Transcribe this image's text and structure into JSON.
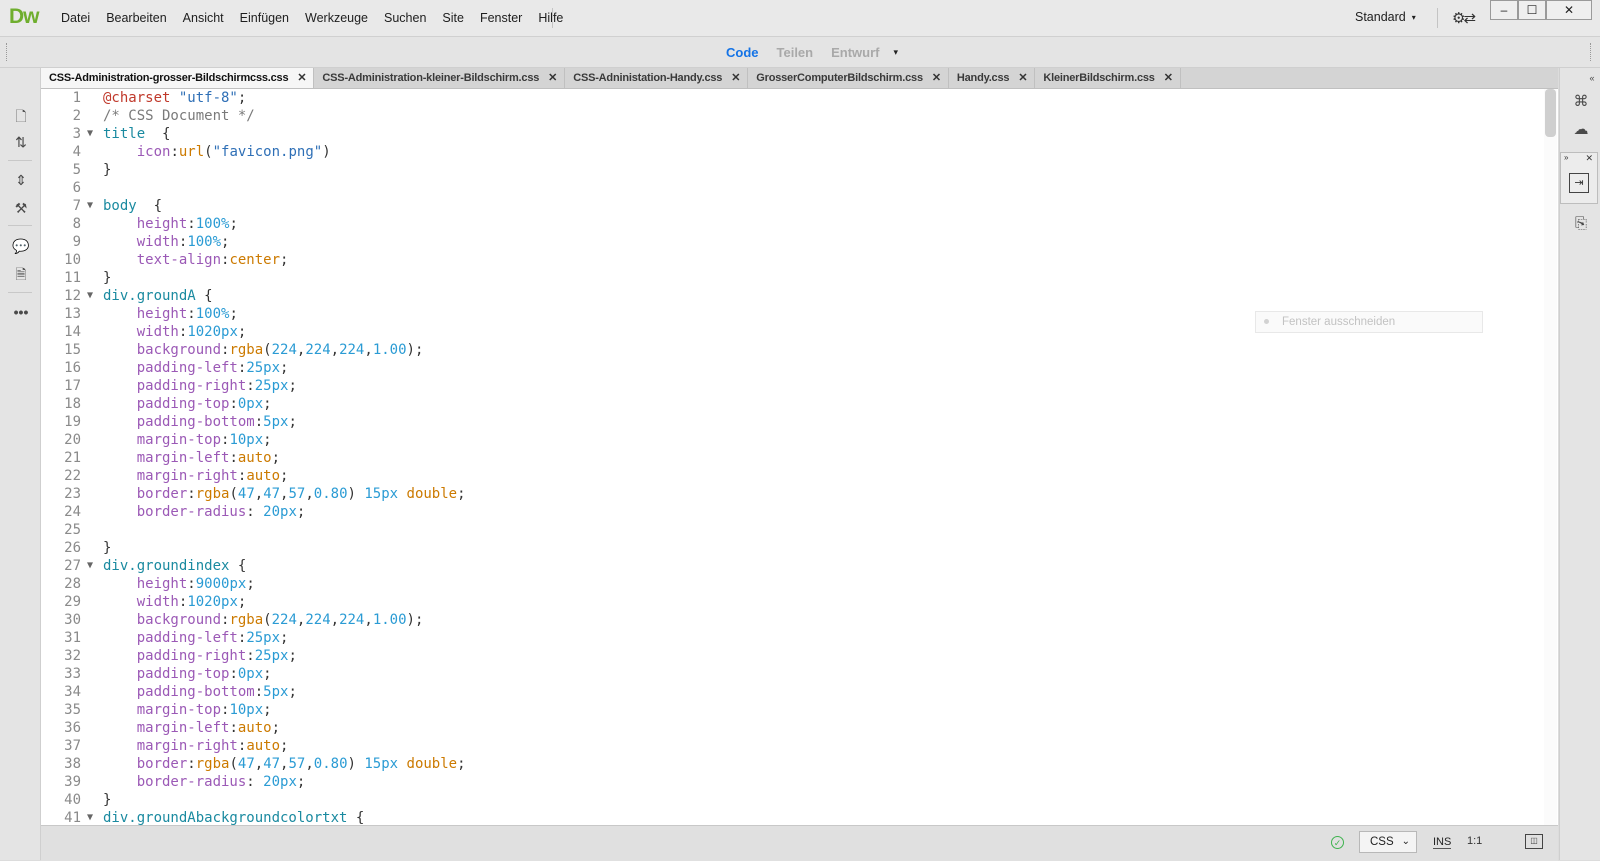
{
  "app": {
    "logo": "Dw"
  },
  "menu": [
    "Datei",
    "Bearbeiten",
    "Ansicht",
    "Einfügen",
    "Werkzeuge",
    "Suchen",
    "Site",
    "Fenster",
    "Hilfe"
  ],
  "workspace": {
    "label": "Standard",
    "caret": "▾"
  },
  "window_controls": {
    "minimize": "–",
    "maximize": "☐",
    "close": "✕"
  },
  "view_switcher": {
    "code": "Code",
    "share": "Teilen",
    "design": "Entwurf",
    "caret": "▾"
  },
  "tabs": [
    {
      "label": "CSS-Administration-grosser-Bildschirmcss.css",
      "active": true
    },
    {
      "label": "CSS-Administration-kleiner-Bildschirm.css",
      "active": false
    },
    {
      "label": "CSS-Adninistation-Handy.css",
      "active": false
    },
    {
      "label": "GrosserComputerBildschirm.css",
      "active": false
    },
    {
      "label": "Handy.css",
      "active": false
    },
    {
      "label": "KleinerBildschirm.css",
      "active": false
    }
  ],
  "tab_close": "✕",
  "code_lines": [
    {
      "n": "1",
      "fold": false,
      "tokens": [
        [
          "at",
          "@charset "
        ],
        [
          "str",
          "\"utf-8\""
        ],
        [
          "pun",
          ";"
        ]
      ]
    },
    {
      "n": "2",
      "fold": false,
      "tokens": [
        [
          "cmt",
          "/* CSS Document */"
        ]
      ]
    },
    {
      "n": "3",
      "fold": true,
      "tokens": [
        [
          "sel",
          "title  "
        ],
        [
          "pun",
          "{"
        ]
      ]
    },
    {
      "n": "4",
      "fold": false,
      "tokens": [
        [
          "pun",
          "    "
        ],
        [
          "prop",
          "icon"
        ],
        [
          "pun",
          ":"
        ],
        [
          "kw",
          "url"
        ],
        [
          "pun",
          "("
        ],
        [
          "str",
          "\"favicon.png\""
        ],
        [
          "pun",
          ")"
        ]
      ]
    },
    {
      "n": "5",
      "fold": false,
      "tokens": [
        [
          "pun",
          "}"
        ]
      ]
    },
    {
      "n": "6",
      "fold": false,
      "tokens": []
    },
    {
      "n": "7",
      "fold": true,
      "tokens": [
        [
          "sel",
          "body  "
        ],
        [
          "pun",
          "{"
        ]
      ]
    },
    {
      "n": "8",
      "fold": false,
      "tokens": [
        [
          "pun",
          "    "
        ],
        [
          "prop",
          "height"
        ],
        [
          "pun",
          ":"
        ],
        [
          "num",
          "100%"
        ],
        [
          "pun",
          ";"
        ]
      ]
    },
    {
      "n": "9",
      "fold": false,
      "tokens": [
        [
          "pun",
          "    "
        ],
        [
          "prop",
          "width"
        ],
        [
          "pun",
          ":"
        ],
        [
          "num",
          "100%"
        ],
        [
          "pun",
          ";"
        ]
      ]
    },
    {
      "n": "10",
      "fold": false,
      "tokens": [
        [
          "pun",
          "    "
        ],
        [
          "prop",
          "text-align"
        ],
        [
          "pun",
          ":"
        ],
        [
          "kw",
          "center"
        ],
        [
          "pun",
          ";"
        ]
      ]
    },
    {
      "n": "11",
      "fold": false,
      "tokens": [
        [
          "pun",
          "}"
        ]
      ]
    },
    {
      "n": "12",
      "fold": true,
      "tokens": [
        [
          "sel",
          "div.groundA "
        ],
        [
          "pun",
          "{"
        ]
      ]
    },
    {
      "n": "13",
      "fold": false,
      "tokens": [
        [
          "pun",
          "    "
        ],
        [
          "prop",
          "height"
        ],
        [
          "pun",
          ":"
        ],
        [
          "num",
          "100%"
        ],
        [
          "pun",
          ";"
        ]
      ]
    },
    {
      "n": "14",
      "fold": false,
      "tokens": [
        [
          "pun",
          "    "
        ],
        [
          "prop",
          "width"
        ],
        [
          "pun",
          ":"
        ],
        [
          "num",
          "1020px"
        ],
        [
          "pun",
          ";"
        ]
      ]
    },
    {
      "n": "15",
      "fold": false,
      "tokens": [
        [
          "pun",
          "    "
        ],
        [
          "prop",
          "background"
        ],
        [
          "pun",
          ":"
        ],
        [
          "kw",
          "rgba"
        ],
        [
          "pun",
          "("
        ],
        [
          "num",
          "224"
        ],
        [
          "pun",
          ","
        ],
        [
          "num",
          "224"
        ],
        [
          "pun",
          ","
        ],
        [
          "num",
          "224"
        ],
        [
          "pun",
          ","
        ],
        [
          "num",
          "1.00"
        ],
        [
          "pun",
          ");"
        ]
      ]
    },
    {
      "n": "16",
      "fold": false,
      "tokens": [
        [
          "pun",
          "    "
        ],
        [
          "prop",
          "padding-left"
        ],
        [
          "pun",
          ":"
        ],
        [
          "num",
          "25px"
        ],
        [
          "pun",
          ";"
        ]
      ]
    },
    {
      "n": "17",
      "fold": false,
      "tokens": [
        [
          "pun",
          "    "
        ],
        [
          "prop",
          "padding-right"
        ],
        [
          "pun",
          ":"
        ],
        [
          "num",
          "25px"
        ],
        [
          "pun",
          ";"
        ]
      ]
    },
    {
      "n": "18",
      "fold": false,
      "tokens": [
        [
          "pun",
          "    "
        ],
        [
          "prop",
          "padding-top"
        ],
        [
          "pun",
          ":"
        ],
        [
          "num",
          "0px"
        ],
        [
          "pun",
          ";"
        ]
      ]
    },
    {
      "n": "19",
      "fold": false,
      "tokens": [
        [
          "pun",
          "    "
        ],
        [
          "prop",
          "padding-bottom"
        ],
        [
          "pun",
          ":"
        ],
        [
          "num",
          "5px"
        ],
        [
          "pun",
          ";"
        ]
      ]
    },
    {
      "n": "20",
      "fold": false,
      "tokens": [
        [
          "pun",
          "    "
        ],
        [
          "prop",
          "margin-top"
        ],
        [
          "pun",
          ":"
        ],
        [
          "num",
          "10px"
        ],
        [
          "pun",
          ";"
        ]
      ]
    },
    {
      "n": "21",
      "fold": false,
      "tokens": [
        [
          "pun",
          "    "
        ],
        [
          "prop",
          "margin-left"
        ],
        [
          "pun",
          ":"
        ],
        [
          "kw",
          "auto"
        ],
        [
          "pun",
          ";"
        ]
      ]
    },
    {
      "n": "22",
      "fold": false,
      "tokens": [
        [
          "pun",
          "    "
        ],
        [
          "prop",
          "margin-right"
        ],
        [
          "pun",
          ":"
        ],
        [
          "kw",
          "auto"
        ],
        [
          "pun",
          ";"
        ]
      ]
    },
    {
      "n": "23",
      "fold": false,
      "tokens": [
        [
          "pun",
          "    "
        ],
        [
          "prop",
          "border"
        ],
        [
          "pun",
          ":"
        ],
        [
          "kw",
          "rgba"
        ],
        [
          "pun",
          "("
        ],
        [
          "num",
          "47"
        ],
        [
          "pun",
          ","
        ],
        [
          "num",
          "47"
        ],
        [
          "pun",
          ","
        ],
        [
          "num",
          "57"
        ],
        [
          "pun",
          ","
        ],
        [
          "num",
          "0.80"
        ],
        [
          "pun",
          ") "
        ],
        [
          "num",
          "15px"
        ],
        [
          "pun",
          " "
        ],
        [
          "kw",
          "double"
        ],
        [
          "pun",
          ";"
        ]
      ]
    },
    {
      "n": "24",
      "fold": false,
      "tokens": [
        [
          "pun",
          "    "
        ],
        [
          "prop",
          "border-radius"
        ],
        [
          "pun",
          ": "
        ],
        [
          "num",
          "20px"
        ],
        [
          "pun",
          ";"
        ]
      ]
    },
    {
      "n": "25",
      "fold": false,
      "tokens": []
    },
    {
      "n": "26",
      "fold": false,
      "tokens": [
        [
          "pun",
          "}"
        ]
      ]
    },
    {
      "n": "27",
      "fold": true,
      "tokens": [
        [
          "sel",
          "div.groundindex "
        ],
        [
          "pun",
          "{"
        ]
      ]
    },
    {
      "n": "28",
      "fold": false,
      "tokens": [
        [
          "pun",
          "    "
        ],
        [
          "prop",
          "height"
        ],
        [
          "pun",
          ":"
        ],
        [
          "num",
          "9000px"
        ],
        [
          "pun",
          ";"
        ]
      ]
    },
    {
      "n": "29",
      "fold": false,
      "tokens": [
        [
          "pun",
          "    "
        ],
        [
          "prop",
          "width"
        ],
        [
          "pun",
          ":"
        ],
        [
          "num",
          "1020px"
        ],
        [
          "pun",
          ";"
        ]
      ]
    },
    {
      "n": "30",
      "fold": false,
      "tokens": [
        [
          "pun",
          "    "
        ],
        [
          "prop",
          "background"
        ],
        [
          "pun",
          ":"
        ],
        [
          "kw",
          "rgba"
        ],
        [
          "pun",
          "("
        ],
        [
          "num",
          "224"
        ],
        [
          "pun",
          ","
        ],
        [
          "num",
          "224"
        ],
        [
          "pun",
          ","
        ],
        [
          "num",
          "224"
        ],
        [
          "pun",
          ","
        ],
        [
          "num",
          "1.00"
        ],
        [
          "pun",
          ");"
        ]
      ]
    },
    {
      "n": "31",
      "fold": false,
      "tokens": [
        [
          "pun",
          "    "
        ],
        [
          "prop",
          "padding-left"
        ],
        [
          "pun",
          ":"
        ],
        [
          "num",
          "25px"
        ],
        [
          "pun",
          ";"
        ]
      ]
    },
    {
      "n": "32",
      "fold": false,
      "tokens": [
        [
          "pun",
          "    "
        ],
        [
          "prop",
          "padding-right"
        ],
        [
          "pun",
          ":"
        ],
        [
          "num",
          "25px"
        ],
        [
          "pun",
          ";"
        ]
      ]
    },
    {
      "n": "33",
      "fold": false,
      "tokens": [
        [
          "pun",
          "    "
        ],
        [
          "prop",
          "padding-top"
        ],
        [
          "pun",
          ":"
        ],
        [
          "num",
          "0px"
        ],
        [
          "pun",
          ";"
        ]
      ]
    },
    {
      "n": "34",
      "fold": false,
      "tokens": [
        [
          "pun",
          "    "
        ],
        [
          "prop",
          "padding-bottom"
        ],
        [
          "pun",
          ":"
        ],
        [
          "num",
          "5px"
        ],
        [
          "pun",
          ";"
        ]
      ]
    },
    {
      "n": "35",
      "fold": false,
      "tokens": [
        [
          "pun",
          "    "
        ],
        [
          "prop",
          "margin-top"
        ],
        [
          "pun",
          ":"
        ],
        [
          "num",
          "10px"
        ],
        [
          "pun",
          ";"
        ]
      ]
    },
    {
      "n": "36",
      "fold": false,
      "tokens": [
        [
          "pun",
          "    "
        ],
        [
          "prop",
          "margin-left"
        ],
        [
          "pun",
          ":"
        ],
        [
          "kw",
          "auto"
        ],
        [
          "pun",
          ";"
        ]
      ]
    },
    {
      "n": "37",
      "fold": false,
      "tokens": [
        [
          "pun",
          "    "
        ],
        [
          "prop",
          "margin-right"
        ],
        [
          "pun",
          ":"
        ],
        [
          "kw",
          "auto"
        ],
        [
          "pun",
          ";"
        ]
      ]
    },
    {
      "n": "38",
      "fold": false,
      "tokens": [
        [
          "pun",
          "    "
        ],
        [
          "prop",
          "border"
        ],
        [
          "pun",
          ":"
        ],
        [
          "kw",
          "rgba"
        ],
        [
          "pun",
          "("
        ],
        [
          "num",
          "47"
        ],
        [
          "pun",
          ","
        ],
        [
          "num",
          "47"
        ],
        [
          "pun",
          ","
        ],
        [
          "num",
          "57"
        ],
        [
          "pun",
          ","
        ],
        [
          "num",
          "0.80"
        ],
        [
          "pun",
          ") "
        ],
        [
          "num",
          "15px"
        ],
        [
          "pun",
          " "
        ],
        [
          "kw",
          "double"
        ],
        [
          "pun",
          ";"
        ]
      ]
    },
    {
      "n": "39",
      "fold": false,
      "tokens": [
        [
          "pun",
          "    "
        ],
        [
          "prop",
          "border-radius"
        ],
        [
          "pun",
          ": "
        ],
        [
          "num",
          "20px"
        ],
        [
          "pun",
          ";"
        ]
      ]
    },
    {
      "n": "40",
      "fold": false,
      "tokens": [
        [
          "pun",
          "}"
        ]
      ]
    },
    {
      "n": "41",
      "fold": true,
      "tokens": [
        [
          "sel",
          "div.groundAbackgroundcolortxt "
        ],
        [
          "pun",
          "{"
        ]
      ]
    }
  ],
  "tooltip": {
    "text": "Fenster ausschneiden"
  },
  "status": {
    "language": "CSS",
    "caret": "⌄",
    "insert_mode": "INS",
    "cursor": "1:1"
  },
  "colors": {
    "accent": "#1473e6",
    "logo": "#6fae2e",
    "status_ok": "#3fb34f"
  }
}
